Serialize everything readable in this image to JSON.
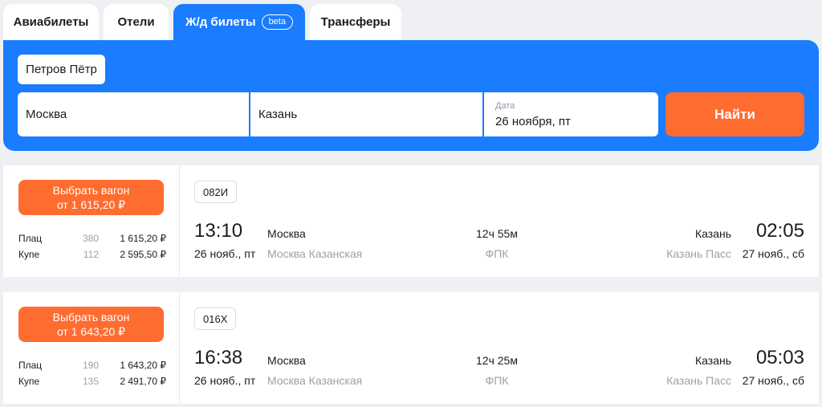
{
  "tabs": [
    {
      "label": "Авиабилеты"
    },
    {
      "label": "Отели"
    },
    {
      "label": "Ж/д билеты",
      "badge": "beta"
    },
    {
      "label": "Трансферы"
    }
  ],
  "search": {
    "passenger": "Петров Пётр",
    "from": "Москва",
    "to": "Казань",
    "date_label": "Дата",
    "date_value": "26 ноября, пт",
    "find_label": "Найти"
  },
  "trains": [
    {
      "choose_label": "Выбрать вагон",
      "choose_price": "от 1 615,20 ₽",
      "classes": [
        {
          "name": "Плац",
          "count": "380",
          "price": "1 615,20 ₽"
        },
        {
          "name": "Купе",
          "count": "112",
          "price": "2 595,50 ₽"
        }
      ],
      "number": "082И",
      "dep_time": "13:10",
      "dep_date": "26 нояб., пт",
      "dep_city": "Москва",
      "dep_station": "Москва Казанская",
      "duration": "12ч 55м",
      "carrier": "ФПК",
      "arr_city": "Казань",
      "arr_station": "Казань Пасс",
      "arr_time": "02:05",
      "arr_date": "27 нояб., сб"
    },
    {
      "choose_label": "Выбрать вагон",
      "choose_price": "от 1 643,20 ₽",
      "classes": [
        {
          "name": "Плац",
          "count": "190",
          "price": "1 643,20 ₽"
        },
        {
          "name": "Купе",
          "count": "135",
          "price": "2 491,70 ₽"
        }
      ],
      "number": "016Х",
      "dep_time": "16:38",
      "dep_date": "26 нояб., пт",
      "dep_city": "Москва",
      "dep_station": "Москва Казанская",
      "duration": "12ч 25м",
      "carrier": "ФПК",
      "arr_city": "Казань",
      "arr_station": "Казань Пасс",
      "arr_time": "05:03",
      "arr_date": "27 нояб., сб"
    }
  ],
  "colors": {
    "accent": "#1a7cff",
    "action": "#ff6c30"
  }
}
